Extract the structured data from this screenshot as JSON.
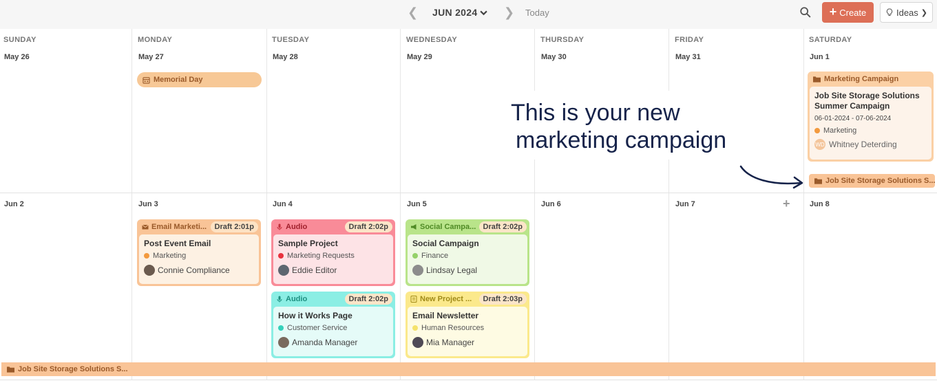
{
  "toolbar": {
    "month": "JUN 2024",
    "today": "Today",
    "create": "Create",
    "ideas": "Ideas",
    "icons": {
      "prev": "chevron-left-icon",
      "next": "chevron-right-icon",
      "search": "search-icon"
    }
  },
  "days": [
    "SUNDAY",
    "MONDAY",
    "TUESDAY",
    "WEDNESDAY",
    "THURSDAY",
    "FRIDAY",
    "SATURDAY"
  ],
  "week1": [
    "May 26",
    "May 27",
    "May 28",
    "May 29",
    "May 30",
    "May 31",
    "Jun 1"
  ],
  "week2": [
    "Jun 2",
    "Jun 3",
    "Jun 4",
    "Jun 5",
    "Jun 6",
    "Jun 7",
    "Jun 8"
  ],
  "holiday": "Memorial Day",
  "campaign": {
    "category": "Marketing Campaign",
    "title": "Job Site Storage Solutions Summer Campaign",
    "dates": "06-01-2024 - 07-06-2024",
    "label": "Marketing",
    "user_initials": "WD",
    "user": "Whitney Deterding",
    "banner": "Job Site Storage Solutions S...",
    "color": "#fbd0a5"
  },
  "banner_week2": "Job Site Storage Solutions S...",
  "cards": [
    {
      "type": "Email Marketi...",
      "badge": "Draft 2:01p",
      "title": "Post Event Email",
      "label": "Marketing",
      "user": "Connie Compliance",
      "color": "#f9c497"
    },
    {
      "type": "Audio",
      "badge": "Draft 2:02p",
      "title": "Sample Project",
      "label": "Marketing Requests",
      "user": "Eddie Editor",
      "color": "#f98b98"
    },
    {
      "type": "Social Campa...",
      "badge": "Draft 2:02p",
      "title": "Social Campaign",
      "label": "Finance",
      "user": "Lindsay Legal",
      "color": "#b9e48a"
    },
    {
      "type": "Audio",
      "badge": "Draft 2:02p",
      "title": "How it Works Page",
      "label": "Customer Service",
      "user": "Amanda Manager",
      "color": "#8beee4"
    },
    {
      "type": "New Project ...",
      "badge": "Draft 2:03p",
      "title": "Email Newsletter",
      "label": "Human Resources",
      "user": "Mia Manager",
      "color": "#fbe98c"
    }
  ],
  "annotation": {
    "line1": "This is your new",
    "line2": "marketing campaign"
  },
  "colors": {
    "accent": "#dd6f57",
    "orange": "#f39a3e",
    "red": "#e8323e",
    "green": "#95d16a",
    "teal": "#35d1bb",
    "yellow": "#f5e26b"
  }
}
